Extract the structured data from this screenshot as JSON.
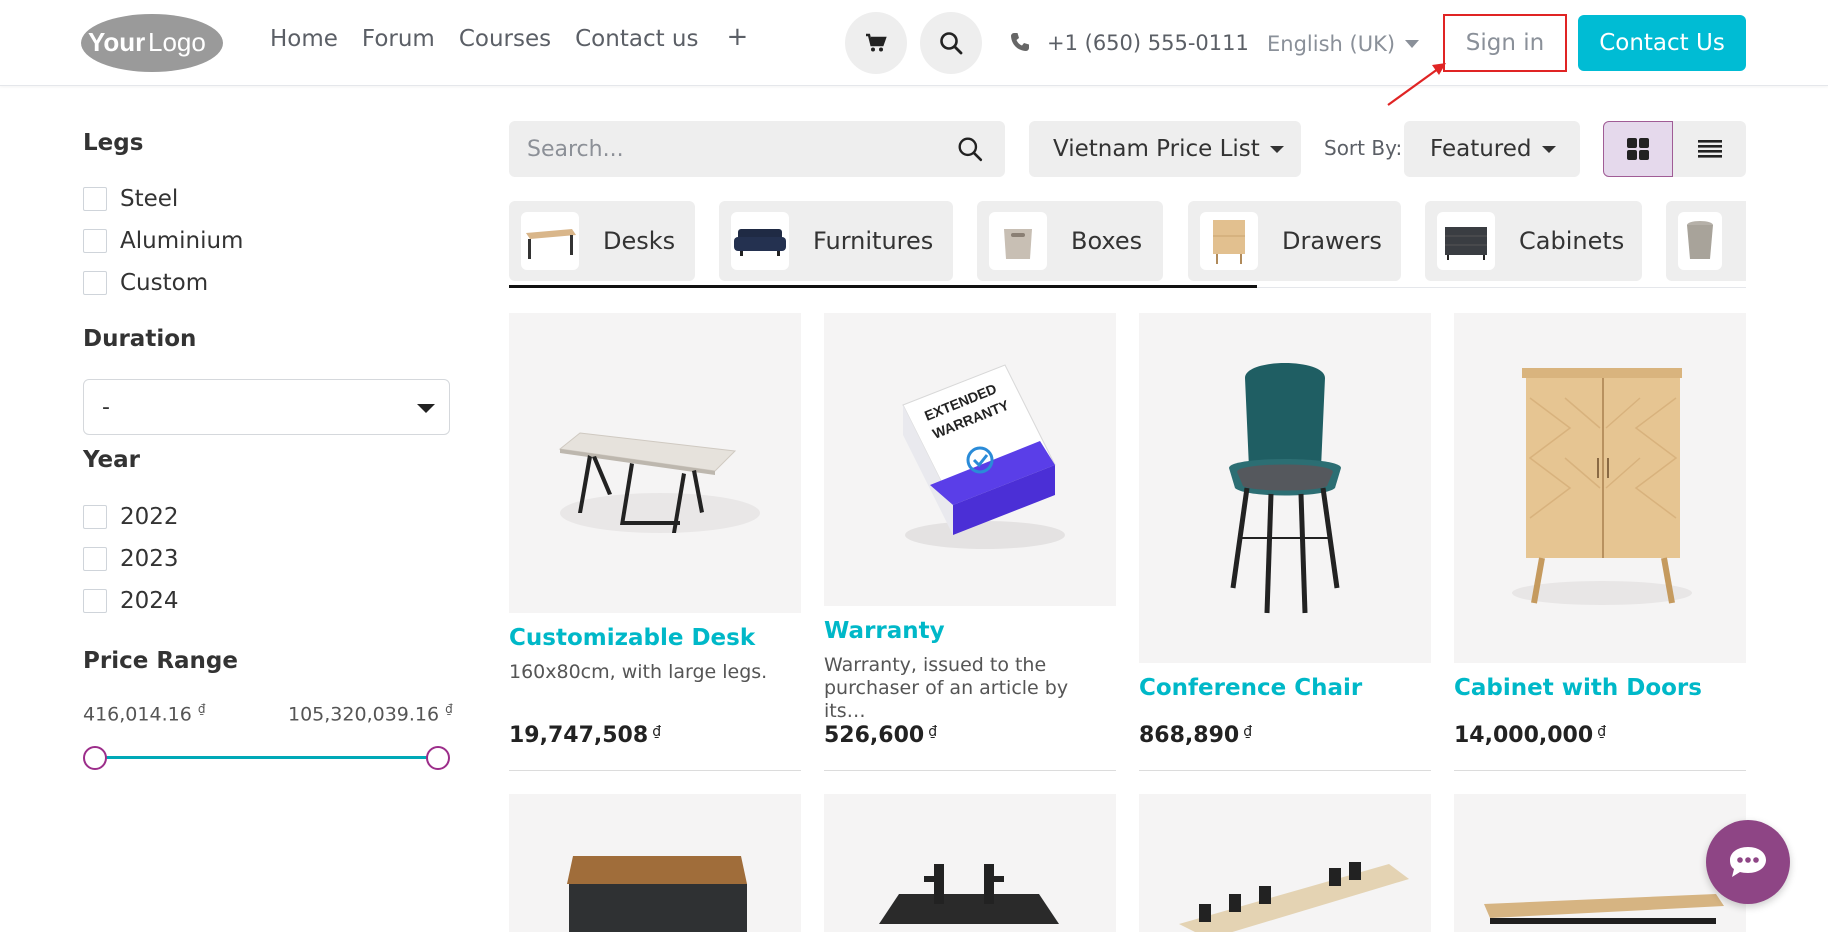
{
  "header": {
    "logo_text": "YourLogo",
    "nav": [
      "Home",
      "Forum",
      "Courses",
      "Contact us"
    ],
    "plus_label": "+",
    "phone": "+1 (650) 555-0111",
    "language": "English (UK)",
    "signin_label": "Sign in",
    "contact_label": "Contact Us",
    "accent_color": "#00bcd4",
    "highlight_color": "#e02424"
  },
  "sidebar": {
    "legs": {
      "title": "Legs",
      "options": [
        "Steel",
        "Aluminium",
        "Custom"
      ]
    },
    "duration": {
      "title": "Duration",
      "selected": "-"
    },
    "year": {
      "title": "Year",
      "options": [
        "2022",
        "2023",
        "2024"
      ]
    },
    "price_range": {
      "title": "Price Range",
      "min": "416,014.16",
      "max": "105,320,039.16",
      "currency": "₫"
    }
  },
  "toolbar": {
    "search_placeholder": "Search...",
    "pricelist": "Vietnam Price List",
    "sort_label": "Sort By:",
    "sort_value": "Featured"
  },
  "categories": [
    "Desks",
    "Furnitures",
    "Boxes",
    "Drawers",
    "Cabinets"
  ],
  "products": [
    {
      "name": "Customizable Desk",
      "desc": "160x80cm, with large legs.",
      "price": "19,747,508",
      "currency": "₫"
    },
    {
      "name": "Warranty",
      "desc": "Warranty, issued to the purchaser of an article by its…",
      "price": "526,600",
      "currency": "₫"
    },
    {
      "name": "Conference Chair",
      "desc": "",
      "price": "868,890",
      "currency": "₫"
    },
    {
      "name": "Cabinet with Doors",
      "desc": "",
      "price": "14,000,000",
      "currency": "₫"
    }
  ],
  "warranty_box_text": "EXTENDED WARRANTY"
}
